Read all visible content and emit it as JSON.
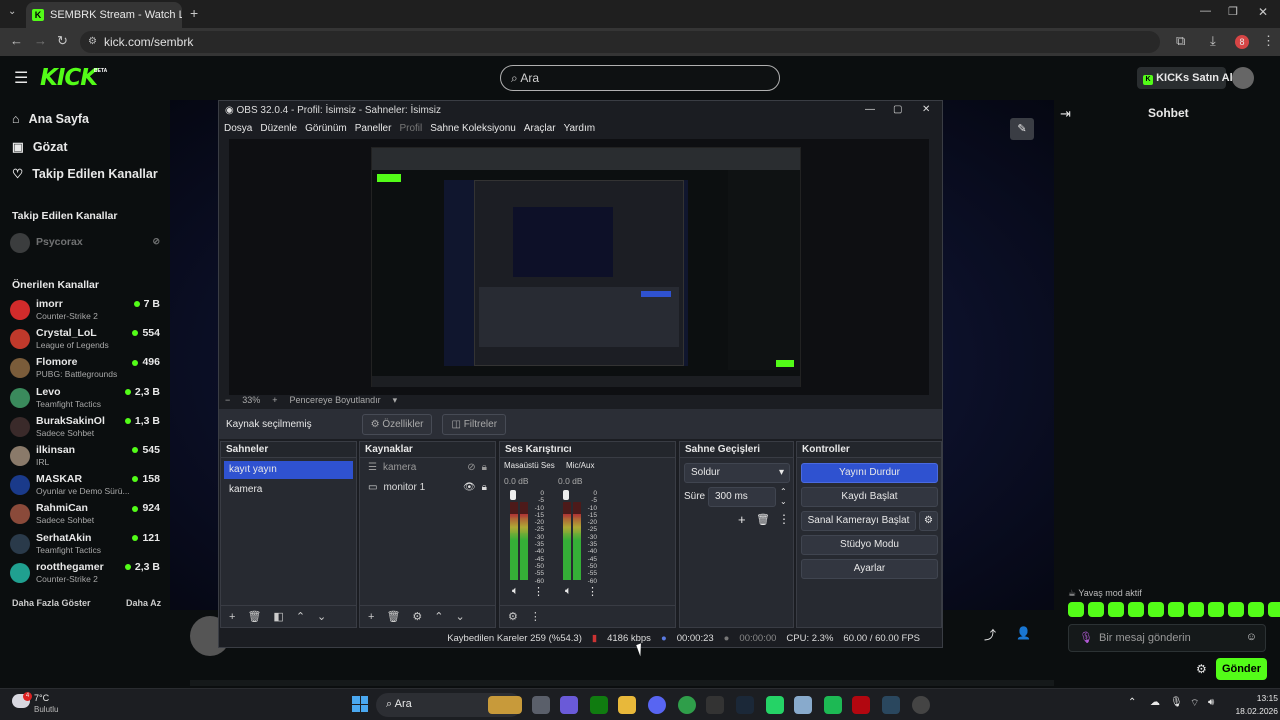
{
  "browser": {
    "tab_title": "SEMBRK Stream - Watch Live o",
    "url": "kick.com/sembrk",
    "profile_badge": "8"
  },
  "kick": {
    "logo": "KICK",
    "logo_beta": "BETA",
    "search_placeholder": "Ara",
    "kicks_button": "KICKs Satın Al",
    "nav": [
      {
        "label": "Ana Sayfa",
        "icon": "home-icon"
      },
      {
        "label": "Gözat",
        "icon": "browse-icon"
      },
      {
        "label": "Takip Edilen Kanallar",
        "icon": "heart-icon"
      }
    ],
    "followed_title": "Takip Edilen Kanallar",
    "followed": [
      {
        "name": "Psycorax"
      }
    ],
    "recommended_title": "Önerilen Kanallar",
    "recommended": [
      {
        "name": "imorr",
        "game": "Counter-Strike 2",
        "viewers": "7 B",
        "color": "#d22b2b"
      },
      {
        "name": "Crystal_LoL",
        "game": "League of Legends",
        "viewers": "554",
        "color": "#c0392b"
      },
      {
        "name": "Flomore",
        "game": "PUBG: Battlegrounds",
        "viewers": "496",
        "color": "#7a5c3a"
      },
      {
        "name": "Levo",
        "game": "Teamfight Tactics",
        "viewers": "2,3 B",
        "color": "#3a8a5c"
      },
      {
        "name": "BurakSakinOl",
        "game": "Sadece Sohbet",
        "viewers": "1,3 B",
        "color": "#3a2a2a"
      },
      {
        "name": "ilkinsan",
        "game": "IRL",
        "viewers": "545",
        "color": "#8a7a6a"
      },
      {
        "name": "MASKAR",
        "game": "Oyunlar ve Demo Sürü...",
        "viewers": "158",
        "color": "#1a3a8a"
      },
      {
        "name": "RahmiCan",
        "game": "Sadece Sohbet",
        "viewers": "924",
        "color": "#8a4a3a"
      },
      {
        "name": "SerhatAkin",
        "game": "Teamfight Tactics",
        "viewers": "121",
        "color": "#2a3a4a"
      },
      {
        "name": "rootthegamer",
        "game": "Counter-Strike 2",
        "viewers": "2,3 B",
        "color": "#20a090"
      }
    ],
    "show_more": "Daha Fazla Göster",
    "show_less": "Daha Az",
    "chat_title": "Sohbet",
    "slow_mode": "Yavaş mod aktif",
    "chat_placeholder": "Bir mesaj gönderin",
    "send_button": "Gönder"
  },
  "obs": {
    "title": "OBS 32.0.4 - Profil: İsimsiz - Sahneler: İsimsiz",
    "menu": [
      "Dosya",
      "Düzenle",
      "Görünüm",
      "Paneller",
      "Profil",
      "Sahne Koleksiyonu",
      "Araçlar",
      "Yardım"
    ],
    "zoom": "33%",
    "fit_label": "Pencereye Boyutlandır",
    "no_source": "Kaynak seçilmemiş",
    "properties": "Özellikler",
    "filters": "Filtreler",
    "scenes_title": "Sahneler",
    "scenes": [
      "kayıt yayın",
      "kamera"
    ],
    "sources_title": "Kaynaklar",
    "sources": [
      "kamera",
      "monitor 1"
    ],
    "mixer_title": "Ses Karıştırıcı",
    "channels": [
      {
        "name": "Masaüstü Ses",
        "db": "0.0 dB"
      },
      {
        "name": "Mic/Aux",
        "db": "0.0 dB"
      }
    ],
    "meter_ticks": [
      "0",
      "-5",
      "-10",
      "-15",
      "-20",
      "-25",
      "-30",
      "-35",
      "-40",
      "-45",
      "-50",
      "-55",
      "-60"
    ],
    "transitions_title": "Sahne Geçişleri",
    "transition": "Soldur",
    "duration_label": "Süre",
    "duration": "300 ms",
    "controls_title": "Kontroller",
    "controls": [
      "Yayını Durdur",
      "Kaydı Başlat",
      "Sanal Kamerayı Başlat",
      "Stüdyo Modu",
      "Ayarlar"
    ],
    "status": {
      "dropped": "Kaybedilen Kareler 259 (%54.3)",
      "bitrate": "4186 kbps",
      "stream_time": "00:00:23",
      "rec_time": "00:00:00",
      "cpu": "CPU: 2.3%",
      "fps": "60.00 / 60.00 FPS"
    }
  },
  "taskbar": {
    "weather_temp": "7°C",
    "weather_desc": "Bulutlu",
    "search": "Ara",
    "time": "13:15",
    "date": "18.02.2026",
    "weather_badge": "4"
  }
}
